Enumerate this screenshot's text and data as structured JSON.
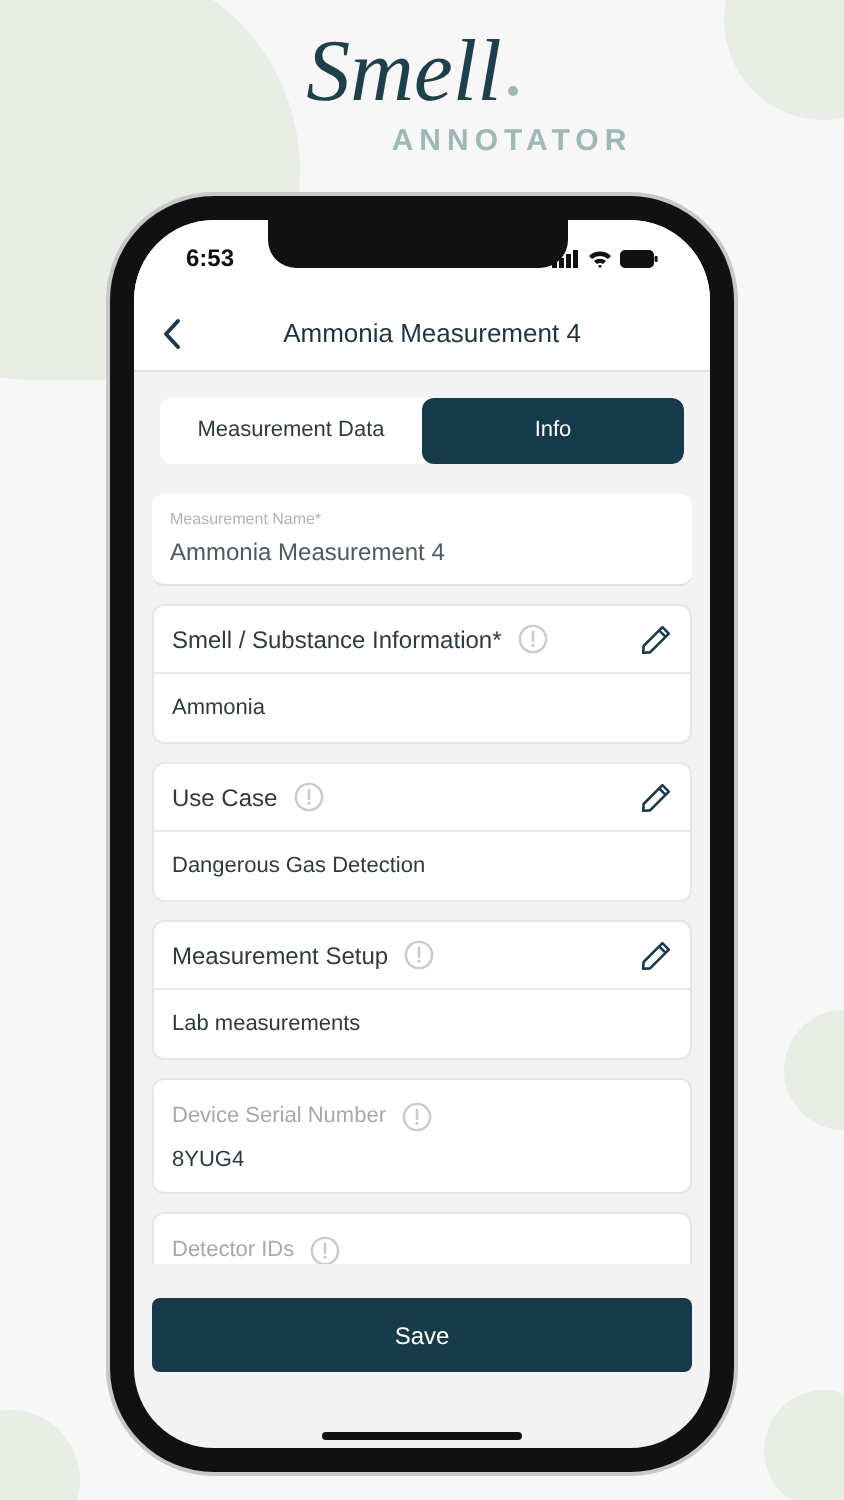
{
  "logo": {
    "wordmark": "Smell",
    "subtitle": "ANNOTATOR"
  },
  "status_bar": {
    "time": "6:53"
  },
  "header": {
    "title": "Ammonia Measurement 4"
  },
  "tabs": [
    {
      "label": "Measurement Data",
      "selected": false
    },
    {
      "label": "Info",
      "selected": true
    }
  ],
  "name_field": {
    "label": "Measurement Name*",
    "value": "Ammonia Measurement 4"
  },
  "sections": [
    {
      "kind": "editable",
      "title": "Smell / Substance Information*",
      "value": "Ammonia"
    },
    {
      "kind": "editable",
      "title": "Use Case",
      "value": "Dangerous Gas Detection"
    },
    {
      "kind": "editable",
      "title": "Measurement Setup",
      "value": "Lab measurements"
    },
    {
      "kind": "readonly",
      "title": "Device Serial Number",
      "value": "8YUG4"
    },
    {
      "kind": "readonly",
      "title": "Detector IDs"
    }
  ],
  "save_button": "Save"
}
